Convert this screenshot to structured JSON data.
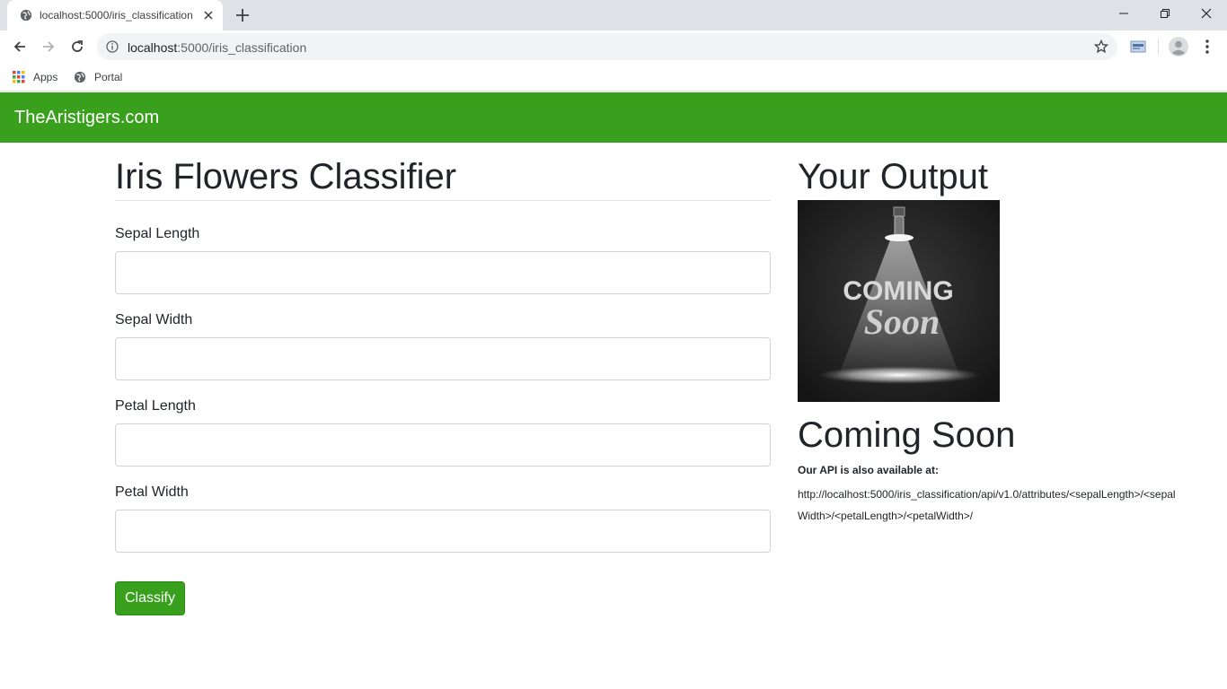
{
  "browser": {
    "tab_title": "localhost:5000/iris_classification",
    "url_host": "localhost",
    "url_path": ":5000/iris_classification",
    "bookmarks": [
      {
        "label": "Apps",
        "icon": "apps-grid-icon"
      },
      {
        "label": "Portal",
        "icon": "globe-icon"
      }
    ]
  },
  "navbar": {
    "brand": "TheAristigers.com",
    "color": "#38a01d"
  },
  "form": {
    "title": "Iris Flowers Classifier",
    "fields": [
      {
        "label": "Sepal Length",
        "value": ""
      },
      {
        "label": "Sepal Width",
        "value": ""
      },
      {
        "label": "Petal Length",
        "value": ""
      },
      {
        "label": "Petal Width",
        "value": ""
      }
    ],
    "submit_label": "Classify"
  },
  "output": {
    "title": "Your Output",
    "image_text_top": "COMING",
    "image_text_bottom": "Soon",
    "heading": "Coming Soon",
    "api_label": "Our API is also available at:",
    "api_url": "http://localhost:5000/iris_classification/api/v1.0/attributes/<sepalLength>/<sepalWidth>/<petalLength>/<petalWidth>/"
  }
}
